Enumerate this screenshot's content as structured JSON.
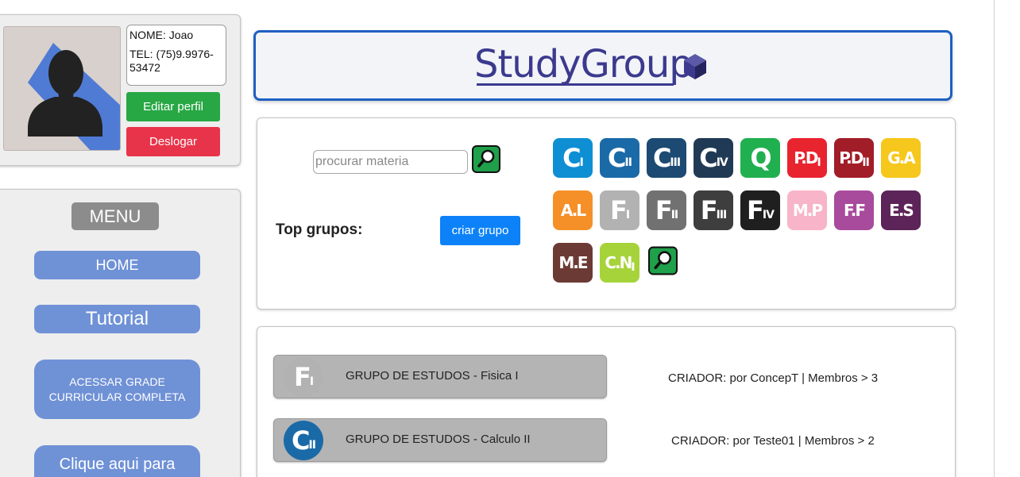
{
  "profile": {
    "name_line": "NOME: Joao",
    "tel_line": "TEL: (75)9.9976-53472",
    "edit_label": "Editar perfil",
    "logout_label": "Deslogar"
  },
  "menu": {
    "title": "MENU",
    "home_label": "HOME",
    "tutorial_label": "Tutorial",
    "grade_label": "ACESSAR GRADE CURRICULAR COMPLETA",
    "clique_label": "Clique aqui para"
  },
  "logo": {
    "text": "StudyGroup",
    "color": "#3c3a8e",
    "icon": "cube-icon"
  },
  "search": {
    "placeholder": "procurar materia",
    "value": "",
    "button_icon": "magnifier-icon",
    "top_label": "Top grupos:",
    "create_label": "criar grupo"
  },
  "subjects": [
    {
      "main": "C",
      "sub": "I",
      "color": "#0e8fd4"
    },
    {
      "main": "C",
      "sub": "II",
      "color": "#1b6aa8"
    },
    {
      "main": "C",
      "sub": "III",
      "color": "#1c4a72"
    },
    {
      "main": "C",
      "sub": "IV",
      "color": "#203a55"
    },
    {
      "main": "Q",
      "sub": "",
      "color": "#21b04f"
    },
    {
      "main": "P.D",
      "sub": "I",
      "color": "#e8242f"
    },
    {
      "main": "P.D",
      "sub": "II",
      "color": "#a11d28"
    },
    {
      "main": "G.A",
      "sub": "",
      "color": "#f6c71c"
    },
    {
      "main": "A.L",
      "sub": "",
      "color": "#f58f28"
    },
    {
      "main": "F",
      "sub": "I",
      "color": "#b2b2b2"
    },
    {
      "main": "F",
      "sub": "II",
      "color": "#717171"
    },
    {
      "main": "F",
      "sub": "III",
      "color": "#3e3e3e"
    },
    {
      "main": "F",
      "sub": "IV",
      "color": "#1f1f1f"
    },
    {
      "main": "M.P",
      "sub": "",
      "color": "#f8b4c8"
    },
    {
      "main": "F.F",
      "sub": "",
      "color": "#a84b9c"
    },
    {
      "main": "E.S",
      "sub": "",
      "color": "#5c2458"
    },
    {
      "main": "M.E",
      "sub": "",
      "color": "#6c3a34"
    },
    {
      "main": "C.N",
      "sub": "I",
      "color": "#a6d33a"
    }
  ],
  "groups": [
    {
      "icon_main": "F",
      "icon_sub": "I",
      "icon_color": "#b2b2b2",
      "name": "GRUPO DE ESTUDOS - Fisica I",
      "meta": "CRIADOR: por ConcepT | Membros > 3"
    },
    {
      "icon_main": "C",
      "icon_sub": "II",
      "icon_color": "#1b6aa8",
      "name": "GRUPO DE ESTUDOS - Calculo II",
      "meta": "CRIADOR: por Teste01 | Membros > 2"
    }
  ]
}
